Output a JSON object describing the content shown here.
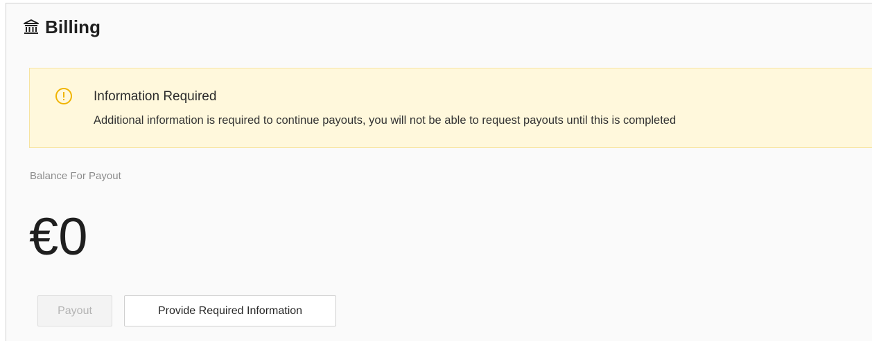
{
  "header": {
    "title": "Billing",
    "icon": "bank-icon"
  },
  "alert": {
    "icon": "warning-circle-icon",
    "title": "Information Required",
    "message": "Additional information is required to continue payouts, you will not be able to request payouts until this is completed",
    "accent_color": "#f0b400",
    "background_color": "#fff8dc",
    "border_color": "#f6e3a0"
  },
  "balance": {
    "label": "Balance For Payout",
    "value": "€0"
  },
  "actions": {
    "payout_label": "Payout",
    "payout_disabled": true,
    "provide_info_label": "Provide Required Information"
  }
}
